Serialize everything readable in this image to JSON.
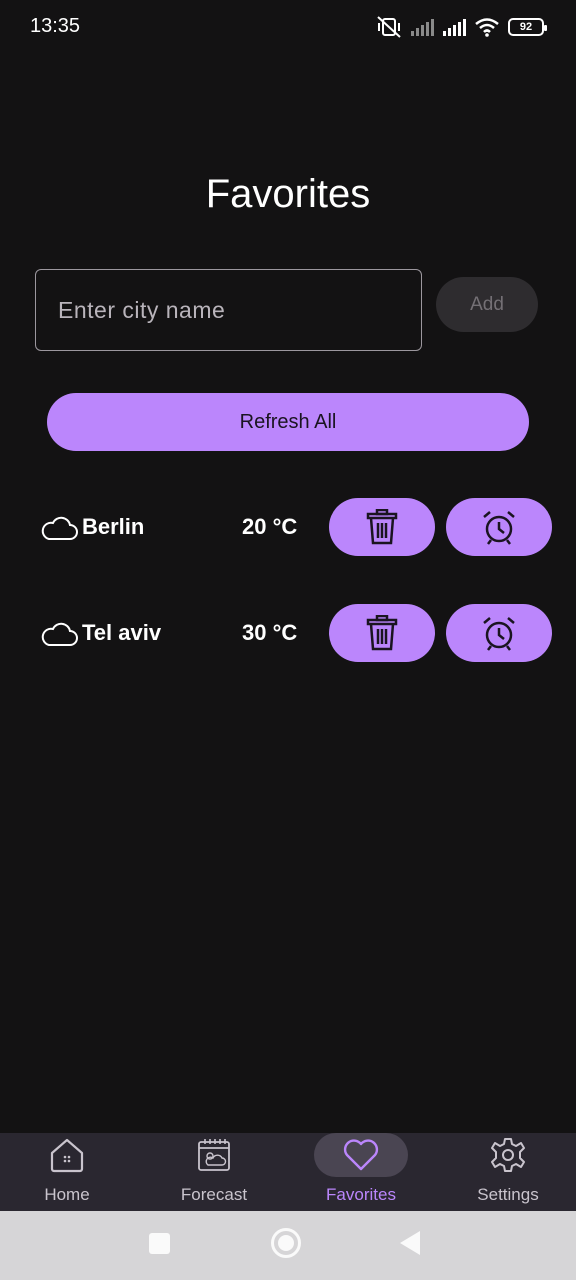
{
  "status_bar": {
    "time": "13:35",
    "battery": "92",
    "icons": [
      "mute-vibrate-icon",
      "signal-icon",
      "signal-icon",
      "wifi-icon",
      "battery-icon"
    ]
  },
  "page": {
    "title": "Favorites"
  },
  "city_input": {
    "placeholder": "Enter city name",
    "value": ""
  },
  "add_button": {
    "label": "Add"
  },
  "refresh_button": {
    "label": "Refresh All"
  },
  "favorites": [
    {
      "city": "Berlin",
      "temp": "20 °C",
      "icon": "cloud-icon"
    },
    {
      "city": "Tel aviv",
      "temp": "30 °C",
      "icon": "cloud-icon"
    }
  ],
  "bottom_nav": {
    "items": [
      {
        "label": "Home",
        "icon": "home-icon"
      },
      {
        "label": "Forecast",
        "icon": "calendar-weather-icon"
      },
      {
        "label": "Favorites",
        "icon": "heart-icon",
        "active": true
      },
      {
        "label": "Settings",
        "icon": "gear-icon"
      }
    ]
  },
  "colors": {
    "background": "#131213",
    "accent": "#bb86fc",
    "nav_background": "#2a2730",
    "system_nav": "#d6d5d7"
  }
}
